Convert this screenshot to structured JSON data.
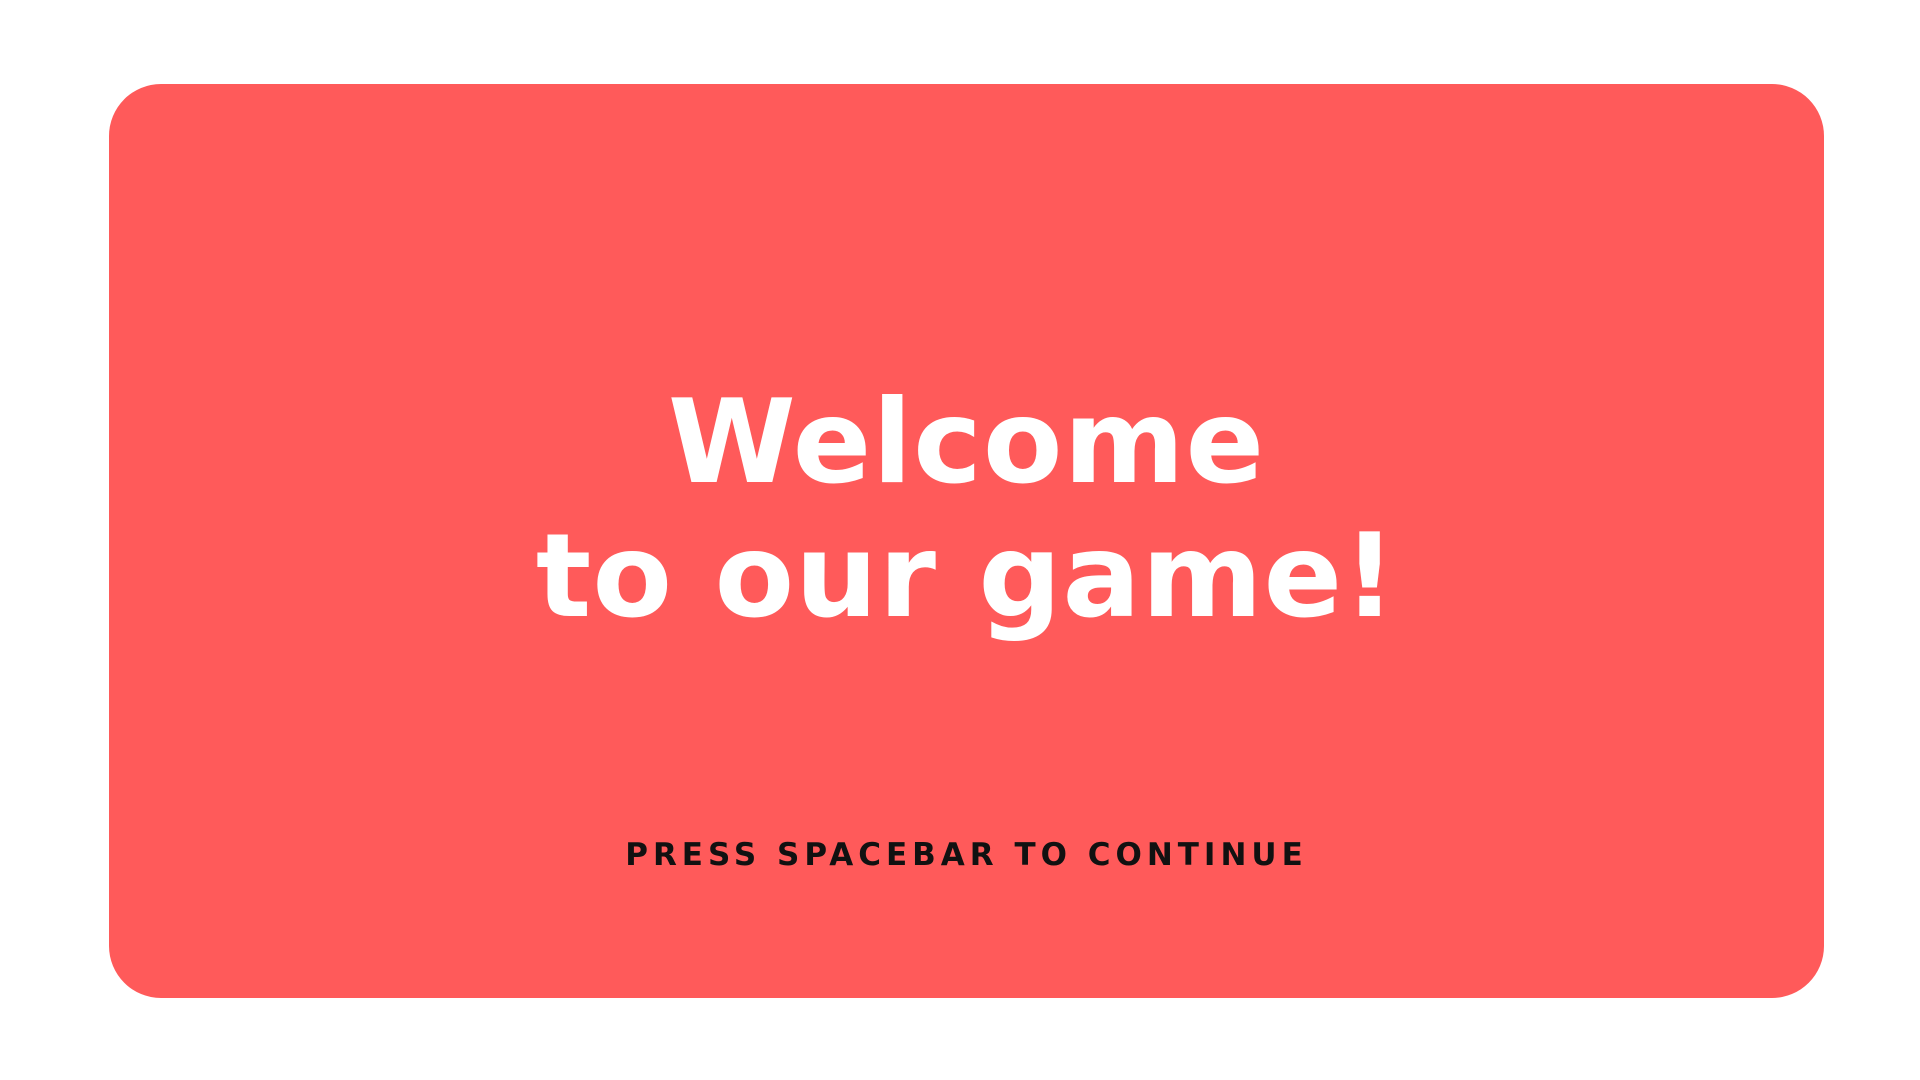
{
  "screen": {
    "title": {
      "line1": "Welcome",
      "line2": "to our game!"
    },
    "prompt": "PRESS SPACEBAR TO CONTINUE"
  },
  "colors": {
    "page_background": "#ffffff",
    "panel_background": "#ff5a5a",
    "title_text": "#ffffff",
    "prompt_text": "#111111"
  }
}
